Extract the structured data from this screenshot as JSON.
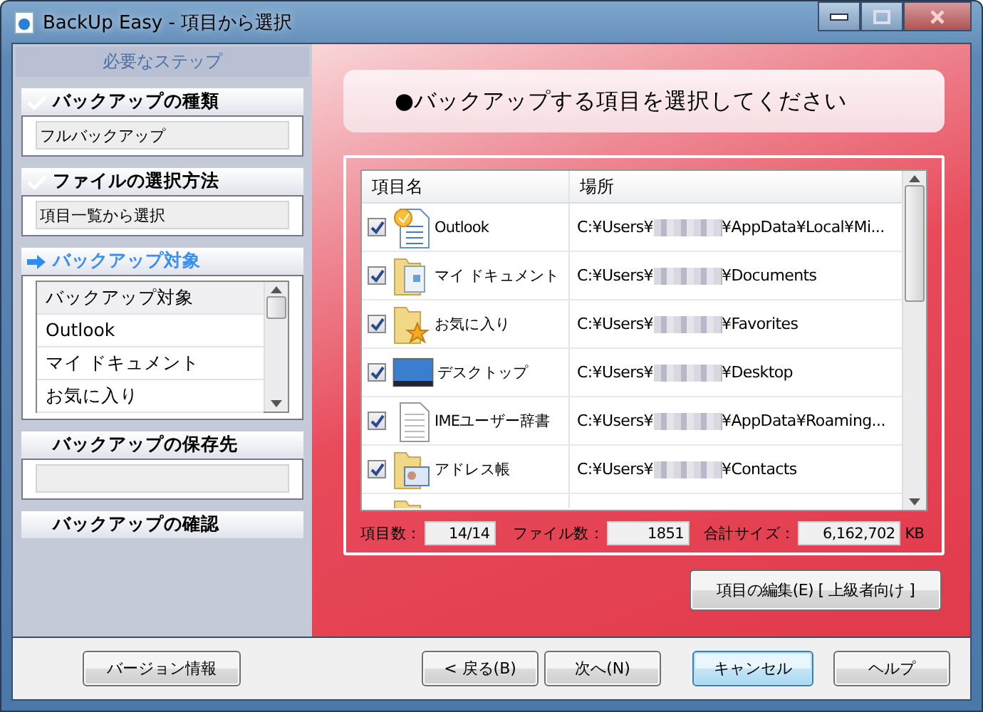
{
  "window": {
    "title": "BackUp Easy - 項目から選択"
  },
  "sidebar": {
    "title": "必要なステップ",
    "steps": [
      {
        "kind": "done",
        "label": "バックアップの種類",
        "field": true,
        "value": "フルバックアップ"
      },
      {
        "kind": "done",
        "label": "ファイルの選択方法",
        "field": true,
        "value": "項目一覧から選択"
      },
      {
        "kind": "current",
        "label": "バックアップ対象",
        "items": [
          {
            "label": "バックアップ対象",
            "selected": true
          },
          {
            "label": "Outlook",
            "selected": false
          },
          {
            "label": "マイ ドキュメント",
            "selected": false
          },
          {
            "label": "お気に入り",
            "selected": false
          }
        ]
      },
      {
        "kind": "pending",
        "label": "バックアップの保存先",
        "field": true
      },
      {
        "kind": "pending",
        "label": "バックアップの確認",
        "field": false
      }
    ]
  },
  "heading": "●バックアップする項目を選択してください",
  "table": {
    "columns": [
      "項目名",
      "場所"
    ],
    "rows": [
      {
        "kind": "mail-doc",
        "checked": true,
        "name": "Outlook",
        "path_start": "C:¥Users¥",
        "path_end": "¥AppData¥Local¥Mi..."
      },
      {
        "kind": "folder-doc",
        "checked": true,
        "name": "マイ ドキュメント",
        "path_start": "C:¥Users¥",
        "path_end": "¥Documents"
      },
      {
        "kind": "folder-star",
        "checked": true,
        "name": "お気に入り",
        "path_start": "C:¥Users¥",
        "path_end": "¥Favorites"
      },
      {
        "kind": "monitor",
        "checked": true,
        "name": "デスクトップ",
        "path_start": "C:¥Users¥",
        "path_end": "¥Desktop"
      },
      {
        "kind": "text-doc",
        "checked": true,
        "name": "IMEユーザー辞書",
        "path_start": "C:¥Users¥",
        "path_end": "¥AppData¥Roaming..."
      },
      {
        "kind": "folder-card",
        "checked": true,
        "name": "アドレス帳",
        "path_start": "C:¥Users¥",
        "path_end": "¥Contacts"
      },
      {
        "kind": "folder"
      }
    ]
  },
  "stats": [
    {
      "label": "項目数：",
      "value": "14/14"
    },
    {
      "label": "ファイル数：",
      "value": "1851"
    },
    {
      "label": "合計サイズ：",
      "value": "6,162,702",
      "unit": "KB"
    }
  ],
  "edit_button": "項目の編集(E) [ 上級者向け ]",
  "buttons": [
    {
      "label": "バージョン情報",
      "focused": false
    },
    {
      "label": "< 戻る(B)",
      "focused": false
    },
    {
      "label": "次へ(N)",
      "focused": false
    },
    {
      "label": "キャンセル",
      "focused": true
    },
    {
      "label": "ヘルプ",
      "focused": false
    }
  ]
}
